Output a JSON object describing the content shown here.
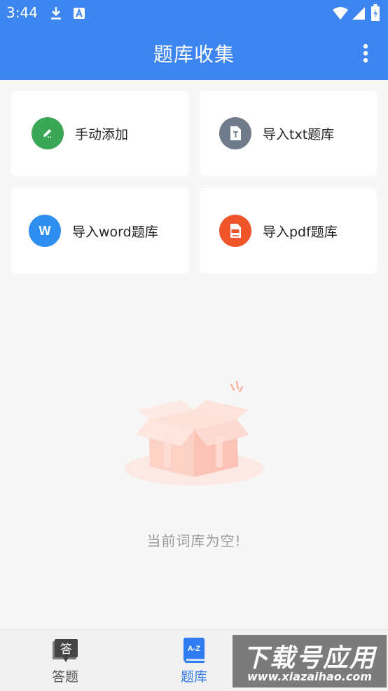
{
  "status_bar": {
    "time": "3:44",
    "left_icons": [
      "download-icon",
      "font-a-icon"
    ],
    "right_icons": [
      "wifi-icon",
      "signal-icon",
      "battery-icon"
    ]
  },
  "app_bar": {
    "title": "题库收集",
    "menu_icon": "more-vertical-icon"
  },
  "actions": [
    {
      "label": "手动添加",
      "icon": "pencil-icon",
      "color": "#3aa757"
    },
    {
      "label": "导入txt题库",
      "icon": "txt-file-icon",
      "color": "#6f7b8a"
    },
    {
      "label": "导入word题库",
      "icon": "word-icon",
      "icon_text": "W",
      "color": "#2e8ff0"
    },
    {
      "label": "导入pdf题库",
      "icon": "pdf-file-icon",
      "color": "#f0552a"
    }
  ],
  "empty_state": {
    "illustration": "empty-box-illustration",
    "message": "当前词库为空!"
  },
  "bottom_nav": {
    "tabs": [
      {
        "label": "答题",
        "icon_text": "答",
        "icon": "answer-icon",
        "active": false
      },
      {
        "label": "题库",
        "icon_text": "A-Z",
        "icon": "question-bank-icon",
        "active": true
      }
    ],
    "active_color": "#2e7cf0",
    "inactive_color": "#555555"
  },
  "watermark": {
    "title": "下载号应用",
    "url": "www.xiazaihao.com"
  }
}
